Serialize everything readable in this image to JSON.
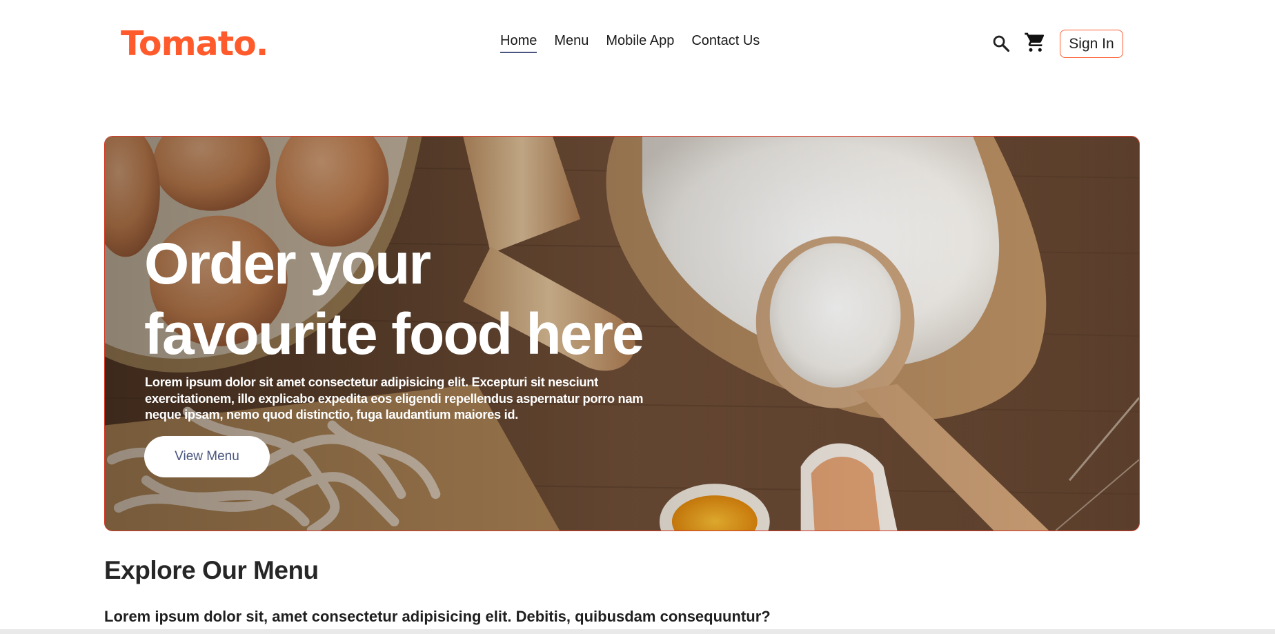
{
  "header": {
    "logo": "Tomato.",
    "nav": [
      {
        "label": "Home",
        "active": true
      },
      {
        "label": "Menu",
        "active": false
      },
      {
        "label": "Mobile App",
        "active": false
      },
      {
        "label": "Contact Us",
        "active": false
      }
    ],
    "icons": [
      "search-icon",
      "cart-icon"
    ],
    "signin_label": "Sign In"
  },
  "hero": {
    "title_line1": "Order your",
    "title_line2": "favourite food here",
    "text": "Lorem ipsum dolor sit amet consectetur adipisicing elit. Excepturi sit nesciunt exercitationem, illo explicabo expedita eos eligendi repellendus aspernatur porro nam neque ipsam, nemo quod distinctio, fuga laudantium maiores id.",
    "button_label": "View Menu"
  },
  "explore": {
    "title": "Explore Our Menu",
    "text": "Lorem ipsum dolor sit, amet consectetur adipisicing elit. Debitis, quibusdam consequuntur?"
  },
  "colors": {
    "brand": "#ff5a2b",
    "hero_border": "#d23b28",
    "nav_underline": "#49557e"
  }
}
